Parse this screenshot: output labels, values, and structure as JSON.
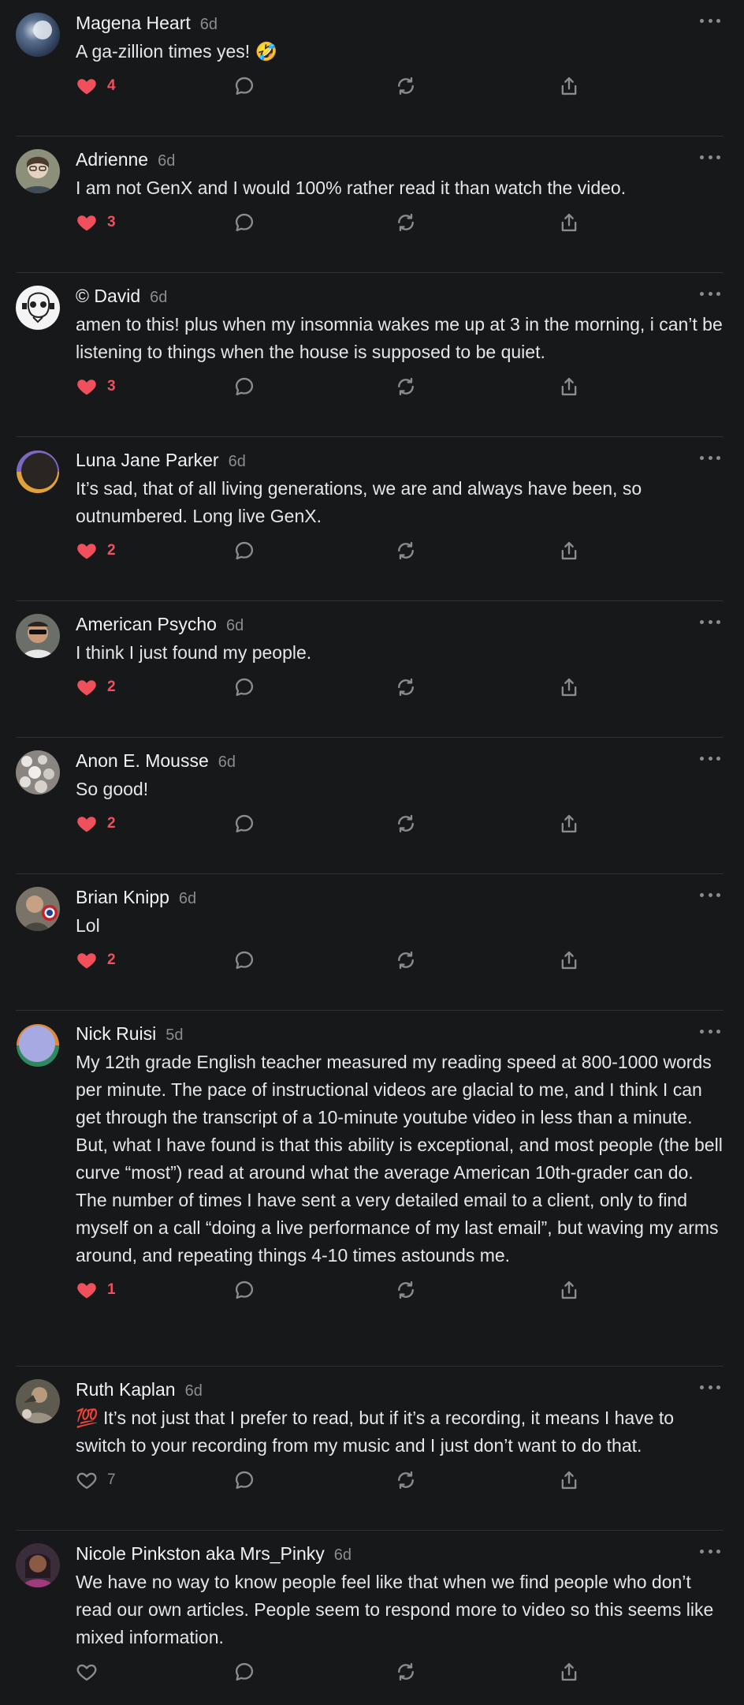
{
  "colors": {
    "background": "#17181a",
    "like_active": "#f0505c",
    "icon_muted": "#8a8c90",
    "divider": "#2e3033"
  },
  "comments": [
    {
      "name": "Magena Heart",
      "time": "6d",
      "text": "A ga-zillion times yes! 🤣",
      "likes": "4",
      "liked": true,
      "avatar": "moon-avatar"
    },
    {
      "name": "Adrienne",
      "time": "6d",
      "text": "I am not GenX and I would 100% rather read it than watch the video.",
      "likes": "3",
      "liked": true,
      "avatar": "photo-avatar"
    },
    {
      "name": "© David",
      "time": "6d",
      "text": "amen to this! plus when my insomnia wakes me up at 3 in the morning, i can’t be listening to things when the house is supposed to be quiet.",
      "likes": "3",
      "liked": true,
      "avatar": "illustration-avatar"
    },
    {
      "name": "Luna Jane Parker",
      "time": "6d",
      "text": "It’s sad, that of all living generations, we are and always have been, so outnumbered. Long live GenX.",
      "likes": "2",
      "liked": true,
      "avatar": "default-avatar"
    },
    {
      "name": "American Psycho",
      "time": "6d",
      "text": "I think I just found my people.",
      "likes": "2",
      "liked": true,
      "avatar": "photo-avatar"
    },
    {
      "name": "Anon E. Mousse",
      "time": "6d",
      "text": "So good!",
      "likes": "2",
      "liked": true,
      "avatar": "flowers-avatar"
    },
    {
      "name": "Brian Knipp",
      "time": "6d",
      "text": "Lol",
      "likes": "2",
      "liked": true,
      "avatar": "photo-avatar"
    },
    {
      "name": "Nick Ruisi",
      "time": "5d",
      "text": "My 12th grade English teacher measured my reading speed at 800-1000 words per minute. The pace of instructional videos are glacial to me, and I think I can get through the transcript of a 10-minute youtube video in less than a minute. But, what I have found is that this ability is exceptional, and most people (the bell curve “most”) read at around what the average American 10th-grader can do. The number of times I have sent a very detailed email to a client, only to find myself on a call “doing a live performance of my last email”, but waving my arms around, and repeating things 4-10 times astounds me.",
      "likes": "1",
      "liked": true,
      "avatar": "default-avatar"
    },
    {
      "name": "Ruth Kaplan",
      "time": "6d",
      "text": "💯 It’s not just that I prefer to read, but if it’s a recording, it means I have to switch to your recording from my music and I just don’t want to do that.",
      "likes": "7",
      "liked": false,
      "avatar": "photo-avatar"
    },
    {
      "name": "Nicole Pinkston aka Mrs_Pinky",
      "time": "6d",
      "text": "We have no way to know people feel like that when we find people who don’t read our own articles. People seem to respond more to video so this seems like mixed information.",
      "likes": "",
      "liked": false,
      "avatar": "photo-avatar"
    }
  ]
}
